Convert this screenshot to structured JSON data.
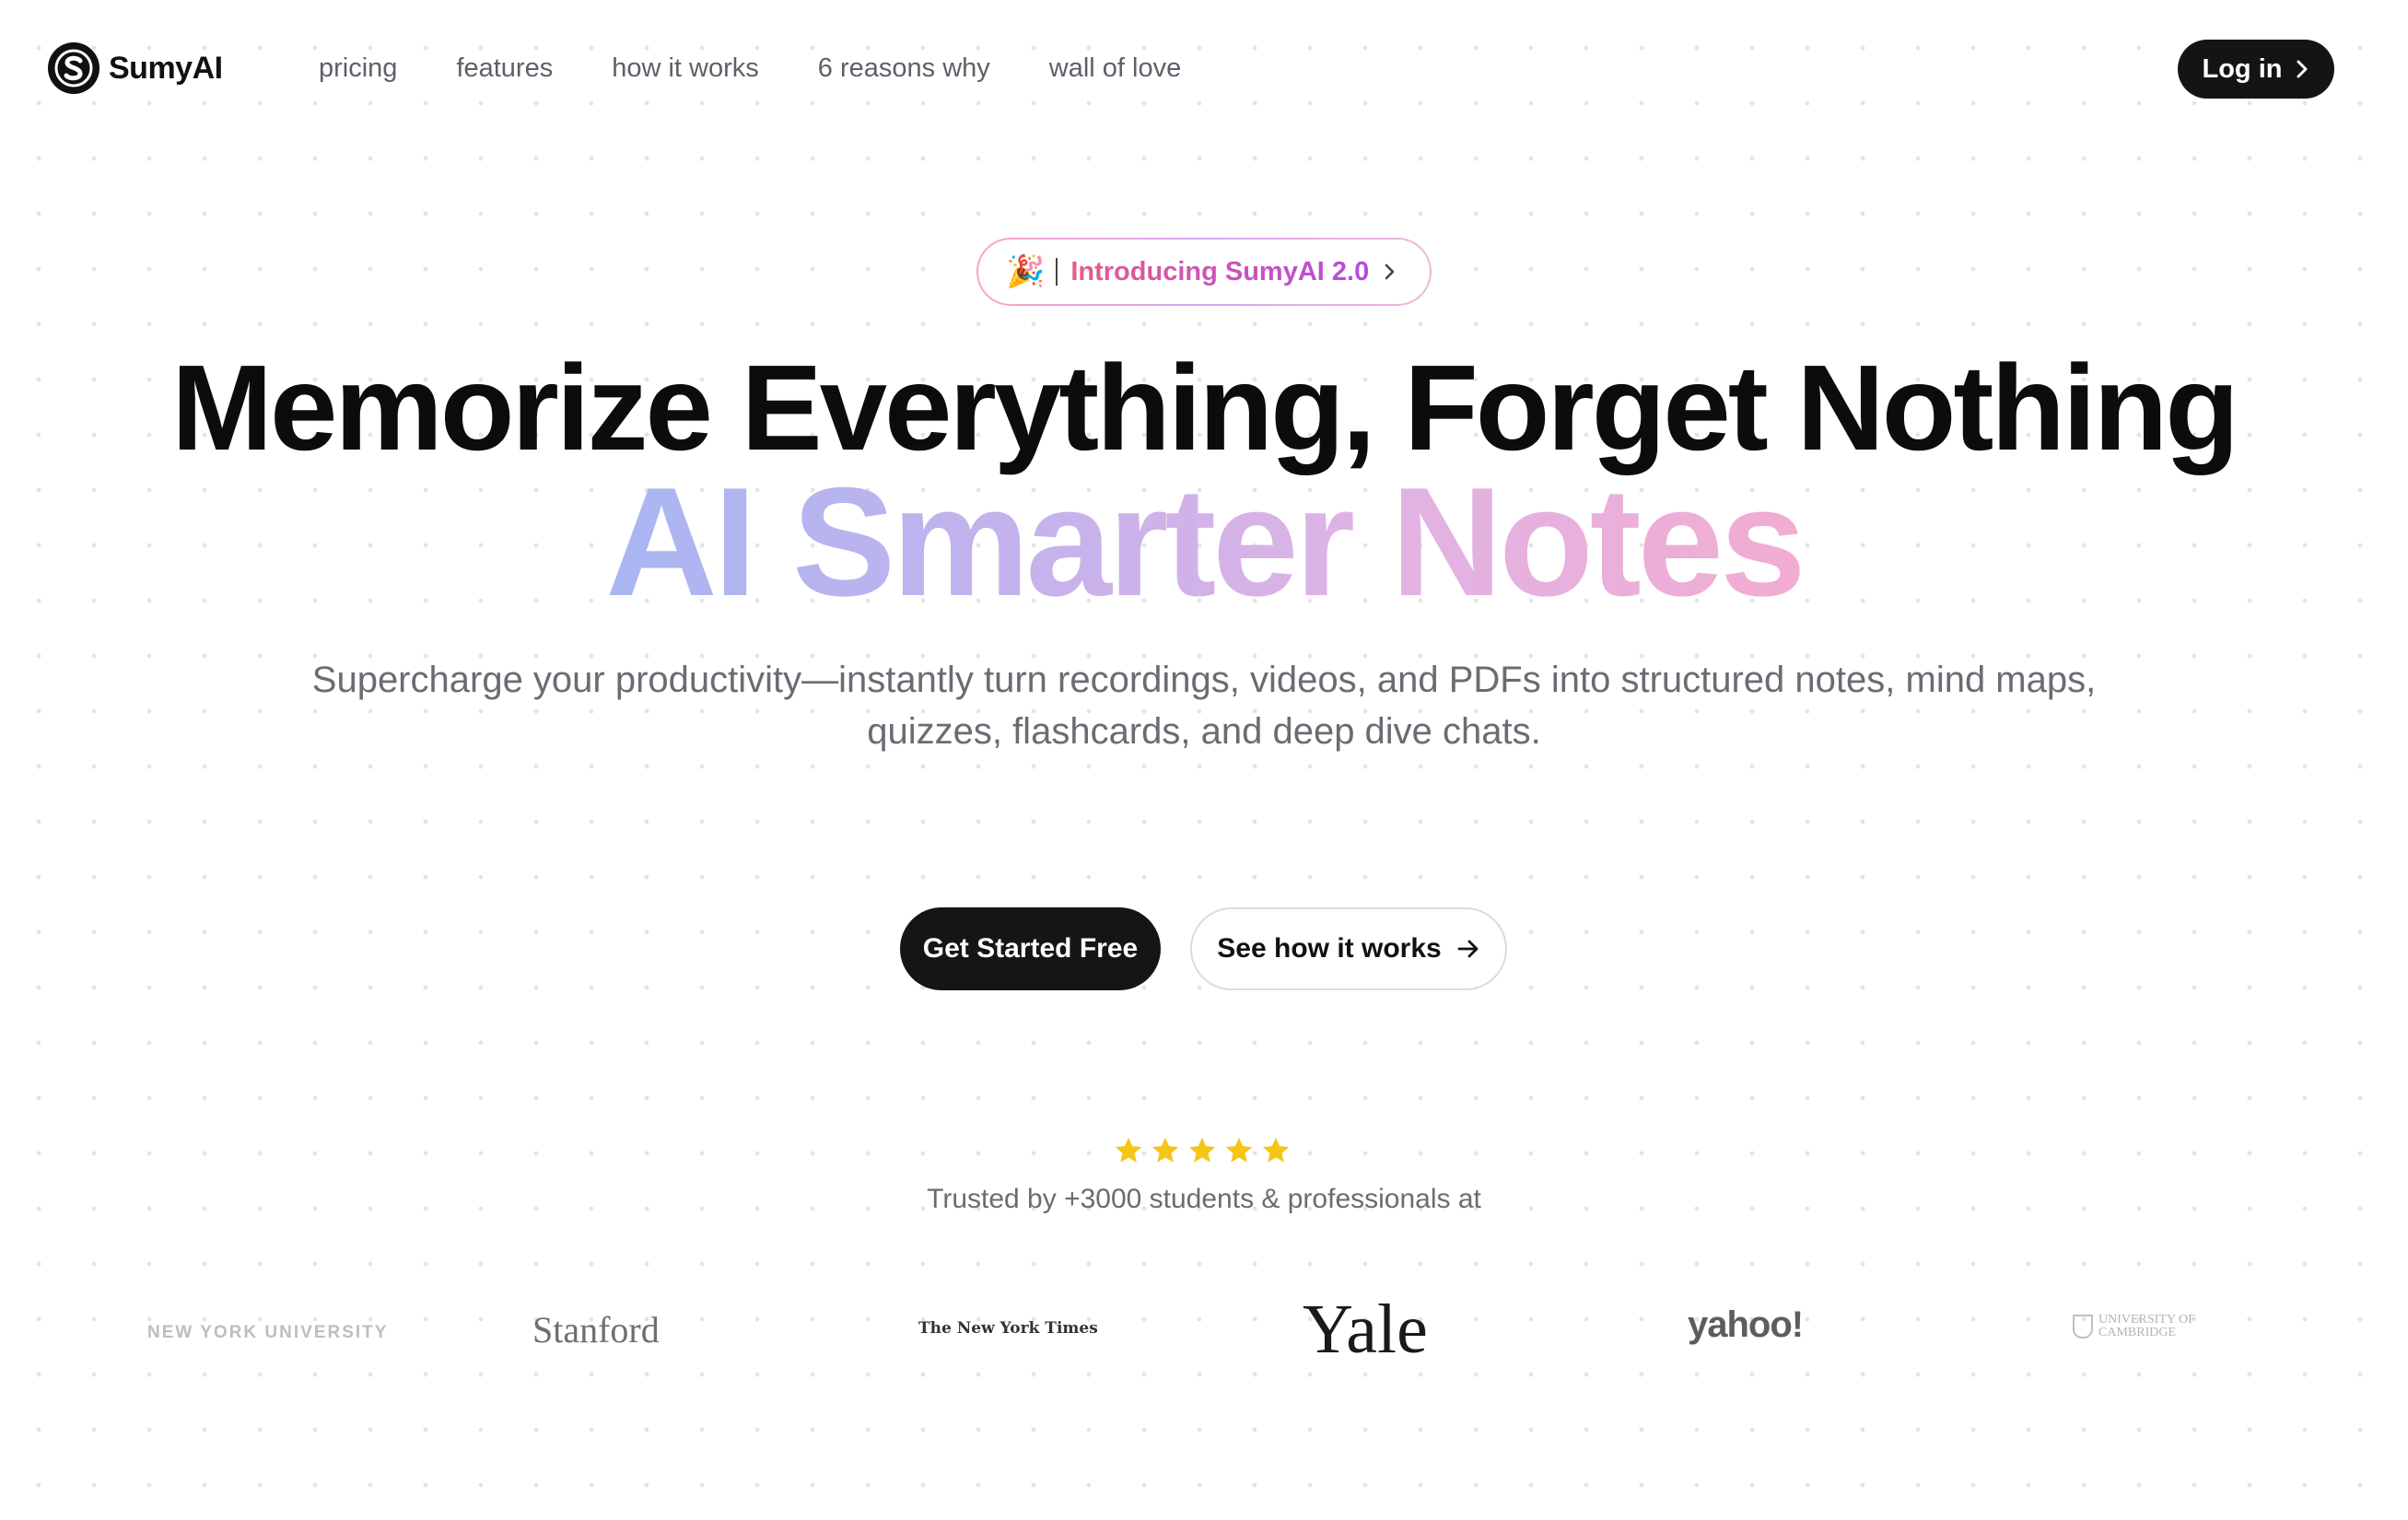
{
  "nav": {
    "brand": "SumyAI",
    "links": [
      "pricing",
      "features",
      "how it works",
      "6 reasons why",
      "wall of love"
    ],
    "login_label": "Log in"
  },
  "hero": {
    "badge_emoji": "🎉",
    "badge_text": "Introducing SumyAI 2.0",
    "headline": "Memorize Everything, Forget Nothing",
    "gradient_headline": "AI Smarter Notes",
    "subheadline": "Supercharge your productivity—instantly turn recordings, videos, and PDFs into structured notes, mind maps, quizzes, flashcards, and deep dive chats.",
    "cta_primary": "Get Started Free",
    "cta_secondary": "See how it works"
  },
  "social_proof": {
    "rating_stars": 5,
    "trusted_text": "Trusted by +3000 students & professionals at",
    "logos": [
      "NEW YORK UNIVERSITY",
      "Stanford",
      "The New York Times",
      "Yale",
      "yahoo!",
      "UNIVERSITY OF CAMBRIDGE"
    ]
  },
  "colors": {
    "primary_dark": "#151515",
    "star": "#f5c518",
    "gradient_start": "#a8b6f2",
    "gradient_end": "#f2acd2",
    "muted_text": "#6b6b73"
  },
  "icons": [
    "sumyai-logo-icon",
    "chevron-right-icon",
    "arrow-right-icon",
    "star-icon"
  ]
}
